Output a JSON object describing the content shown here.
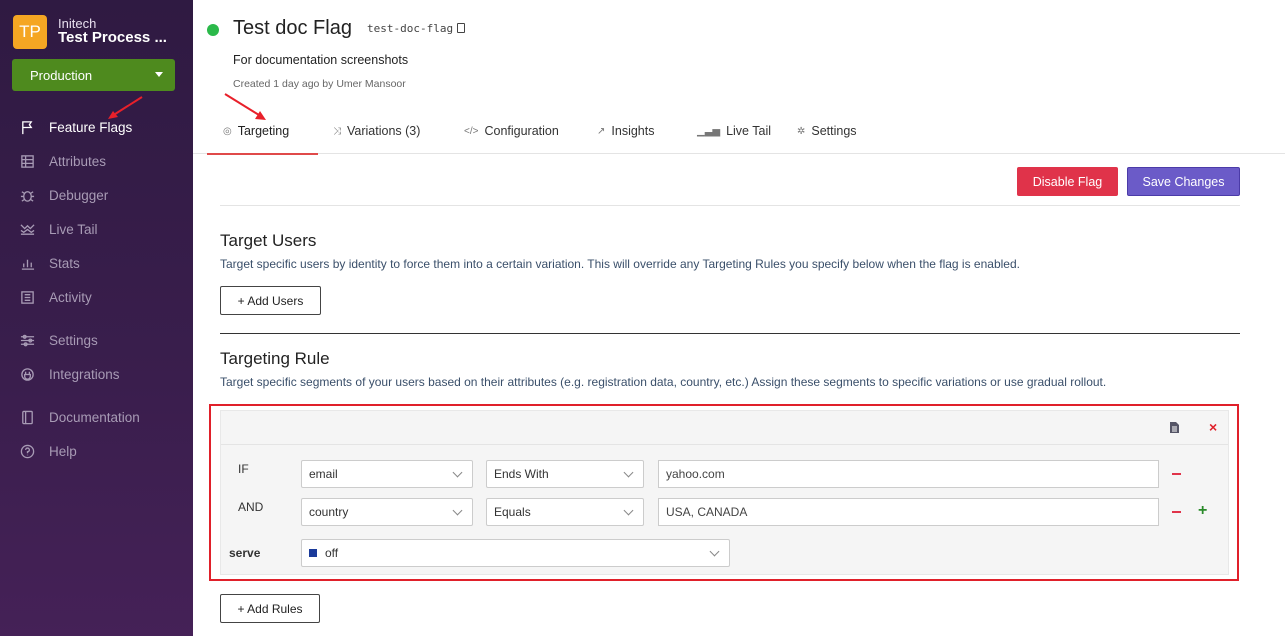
{
  "sidebar": {
    "logo_text": "TP",
    "org": "Initech",
    "project": "Test Process ...",
    "environment": "Production",
    "items": [
      {
        "label": "Feature Flags",
        "icon": "flag-icon"
      },
      {
        "label": "Attributes",
        "icon": "grid-icon"
      },
      {
        "label": "Debugger",
        "icon": "bug-icon"
      },
      {
        "label": "Live Tail",
        "icon": "wave-icon"
      },
      {
        "label": "Stats",
        "icon": "chart-icon"
      },
      {
        "label": "Activity",
        "icon": "list-icon"
      },
      {
        "label": "Settings",
        "icon": "sliders-icon"
      },
      {
        "label": "Integrations",
        "icon": "plug-icon"
      },
      {
        "label": "Documentation",
        "icon": "book-icon"
      },
      {
        "label": "Help",
        "icon": "help-icon"
      }
    ]
  },
  "flag": {
    "title": "Test doc Flag",
    "key": "test-doc-flag",
    "description": "For documentation screenshots",
    "created": "Created 1 day ago by Umer Mansoor",
    "status_color": "#2bb94a"
  },
  "tabs": [
    {
      "label": "Targeting",
      "icon": "◎"
    },
    {
      "label": "Variations (3)",
      "icon": "⤨"
    },
    {
      "label": "Configuration",
      "icon": "</>"
    },
    {
      "label": "Insights",
      "icon": "↗"
    },
    {
      "label": "Live Tail",
      "icon": "▁▃▅"
    },
    {
      "label": "Settings",
      "icon": "✲"
    }
  ],
  "actions": {
    "disable": "Disable Flag",
    "save": "Save Changes"
  },
  "target_users": {
    "title": "Target Users",
    "description": "Target specific users by identity to force them into a certain variation. This will override any Targeting Rules you specify below when the flag is enabled.",
    "add_button": "+ Add Users"
  },
  "targeting_rule": {
    "title": "Targeting Rule",
    "description": "Target specific segments of your users based on their attributes (e.g. registration data, country, etc.) Assign these segments to specific variations or use gradual rollout.",
    "conditions": [
      {
        "keyword": "IF",
        "attribute": "email",
        "operator": "Ends With",
        "value": "yahoo.com"
      },
      {
        "keyword": "AND",
        "attribute": "country",
        "operator": "Equals",
        "value": "USA, CANADA"
      }
    ],
    "serve_label": "serve",
    "serve_value": "off",
    "serve_color": "#1a3a9a",
    "add_rules_button": "+ Add Rules"
  },
  "colors": {
    "accent_red": "#e0334a",
    "accent_purple": "#6b5bc8",
    "env_green": "#4e8a1e",
    "highlight": "#e0202a"
  }
}
